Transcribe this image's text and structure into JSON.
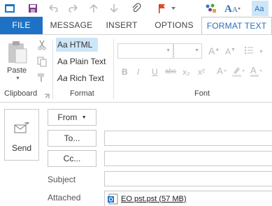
{
  "quick_access": {
    "items": [
      "save-icon",
      "undo-icon",
      "redo-icon",
      "up-icon",
      "down-icon",
      "attach-icon",
      "flag-icon",
      "dropdown-icon",
      "people-icon",
      "text-effects-icon",
      "format-text-icon"
    ]
  },
  "tabs": [
    {
      "label": "FILE"
    },
    {
      "label": "MESSAGE"
    },
    {
      "label": "INSERT"
    },
    {
      "label": "OPTIONS"
    },
    {
      "label": "FORMAT TEXT"
    }
  ],
  "ribbon": {
    "clipboard": {
      "paste_label": "Paste",
      "group_label": "Clipboard"
    },
    "format": {
      "options": [
        {
          "aa": "Aa",
          "label": "HTML"
        },
        {
          "aa": "Aa",
          "label": "Plain Text"
        },
        {
          "aa": "Aa",
          "label": "Rich Text"
        }
      ],
      "group_label": "Format"
    },
    "font": {
      "group_label": "Font",
      "buttons": [
        "B",
        "I",
        "U",
        "abc",
        "x₂",
        "x²"
      ]
    }
  },
  "compose": {
    "send_label": "Send",
    "from_label": "From",
    "to_label": "To...",
    "cc_label": "Cc...",
    "subject_label": "Subject",
    "attached_label": "Attached",
    "attachment_name": "EO pst.pst (57 MB)"
  },
  "colors": {
    "file_tab": "#1e72c6",
    "selected_tab_text": "#2b6fba",
    "selection_bg": "#cde6f7"
  }
}
